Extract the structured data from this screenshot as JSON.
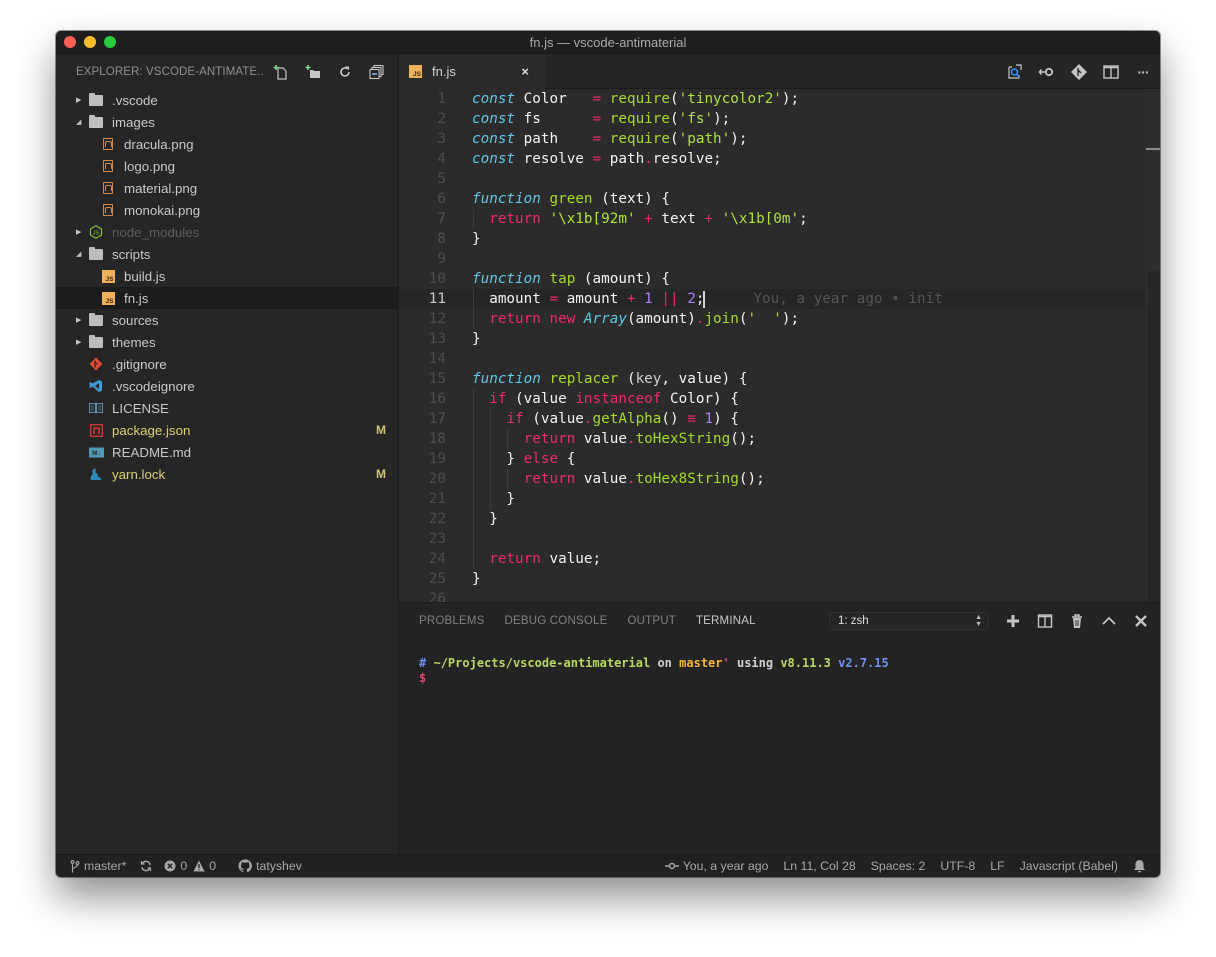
{
  "window": {
    "title": "fn.js — vscode-antimaterial"
  },
  "sidebar": {
    "title": "EXPLORER: VSCODE-ANTIMATE...",
    "actions": [
      "new-file",
      "new-folder",
      "refresh",
      "collapse-all"
    ],
    "items": [
      {
        "label": ".vscode",
        "type": "folder",
        "expanded": false,
        "depth": 0
      },
      {
        "label": "images",
        "type": "folder",
        "expanded": true,
        "depth": 0
      },
      {
        "label": "dracula.png",
        "type": "png",
        "depth": 1
      },
      {
        "label": "logo.png",
        "type": "png",
        "depth": 1
      },
      {
        "label": "material.png",
        "type": "png",
        "depth": 1
      },
      {
        "label": "monokai.png",
        "type": "png",
        "depth": 1
      },
      {
        "label": "node_modules",
        "type": "node-folder",
        "expanded": false,
        "depth": 0,
        "dim": true
      },
      {
        "label": "scripts",
        "type": "folder",
        "expanded": true,
        "depth": 0
      },
      {
        "label": "build.js",
        "type": "js",
        "depth": 1
      },
      {
        "label": "fn.js",
        "type": "js",
        "depth": 1,
        "selected": true
      },
      {
        "label": "sources",
        "type": "folder",
        "expanded": false,
        "depth": 0
      },
      {
        "label": "themes",
        "type": "folder",
        "expanded": false,
        "depth": 0
      },
      {
        "label": ".gitignore",
        "type": "git",
        "depth": 0
      },
      {
        "label": ".vscodeignore",
        "type": "vscode",
        "depth": 0
      },
      {
        "label": "LICENSE",
        "type": "license",
        "depth": 0
      },
      {
        "label": "package.json",
        "type": "npm",
        "depth": 0,
        "modified": true,
        "badge": "M"
      },
      {
        "label": "README.md",
        "type": "markdown",
        "depth": 0
      },
      {
        "label": "yarn.lock",
        "type": "yarn",
        "depth": 0,
        "modified": true,
        "badge": "M"
      }
    ]
  },
  "editor": {
    "tab": {
      "label": "fn.js",
      "close": "×"
    },
    "actions": [
      "open-changes",
      "toggle-blame",
      "git-lens",
      "split-editor",
      "more"
    ],
    "more_label": "···",
    "current_line": 11,
    "blame": "You, a year ago • init",
    "lines": [
      [
        [
          "k-it",
          "const"
        ],
        [
          "",
          "Color   "
        ],
        [
          "k-pink",
          "= "
        ],
        [
          "k-green",
          "require"
        ],
        [
          "",
          "("
        ],
        [
          "k-str",
          "'tinycolor2'"
        ],
        [
          "",
          "); "
        ]
      ],
      [
        [
          "k-it",
          "const"
        ],
        [
          "",
          "fs      "
        ],
        [
          "k-pink",
          "= "
        ],
        [
          "k-green",
          "require"
        ],
        [
          "",
          "("
        ],
        [
          "k-str",
          "'fs'"
        ],
        [
          "",
          ");"
        ]
      ],
      [
        [
          "k-it",
          "const"
        ],
        [
          "",
          "path    "
        ],
        [
          "k-pink",
          "= "
        ],
        [
          "k-green",
          "require"
        ],
        [
          "",
          "("
        ],
        [
          "k-str",
          "'path'"
        ],
        [
          "",
          ");"
        ]
      ],
      [
        [
          "k-it",
          "const"
        ],
        [
          "",
          "resolve "
        ],
        [
          "k-pink",
          "= "
        ],
        [
          "",
          "path"
        ],
        [
          "k-dot",
          "."
        ],
        [
          "",
          "resolve;"
        ]
      ],
      [],
      [
        [
          "k-it",
          "function"
        ],
        [
          "k-green",
          " green"
        ],
        [
          "",
          " (text) {"
        ]
      ],
      [
        [
          "",
          "  "
        ],
        [
          "k-pink",
          "return "
        ],
        [
          "k-str",
          "'\\x1b[92m'"
        ],
        [
          "k-pink",
          " + "
        ],
        [
          "",
          "text"
        ],
        [
          "k-pink",
          " + "
        ],
        [
          "k-str",
          "'\\x1b[0m'"
        ],
        [
          "",
          ";"
        ]
      ],
      [
        [
          "",
          "}"
        ]
      ],
      [],
      [
        [
          "k-it",
          "function"
        ],
        [
          "k-green",
          " tap"
        ],
        [
          "",
          " (amount) {"
        ]
      ],
      [
        [
          "",
          "  amount "
        ],
        [
          "k-pink",
          "= "
        ],
        [
          "",
          "amount "
        ],
        [
          "k-pink",
          "+ "
        ],
        [
          "k-num",
          "1 "
        ],
        [
          "k-pink",
          "|| "
        ],
        [
          "k-num",
          "2"
        ],
        [
          "",
          ";"
        ]
      ],
      [
        [
          "",
          "  "
        ],
        [
          "k-pink",
          "return new "
        ],
        [
          "k-it",
          "Array"
        ],
        [
          "",
          "(amount)"
        ],
        [
          "k-dot",
          "."
        ],
        [
          "k-green",
          "join"
        ],
        [
          "",
          "("
        ],
        [
          "k-str",
          "'  '"
        ],
        [
          "",
          ");"
        ]
      ],
      [
        [
          "",
          "}"
        ]
      ],
      [],
      [
        [
          "k-it",
          "function"
        ],
        [
          "k-green",
          " replacer"
        ],
        [
          "",
          " ("
        ],
        [
          "k-gray",
          "key"
        ],
        [
          "",
          ", value) {"
        ]
      ],
      [
        [
          "",
          "  "
        ],
        [
          "k-pink",
          "if "
        ],
        [
          "",
          "(value "
        ],
        [
          "k-pink",
          "instanceof "
        ],
        [
          "",
          "Color) {"
        ]
      ],
      [
        [
          "",
          "    "
        ],
        [
          "k-pink",
          "if "
        ],
        [
          "",
          "(value"
        ],
        [
          "k-dot",
          "."
        ],
        [
          "k-green",
          "getAlpha"
        ],
        [
          "",
          "() "
        ],
        [
          "k-pink",
          "≡ "
        ],
        [
          "k-num",
          "1"
        ],
        [
          "",
          ") {"
        ]
      ],
      [
        [
          "",
          "      "
        ],
        [
          "k-pink",
          "return "
        ],
        [
          "",
          "value"
        ],
        [
          "k-dot",
          "."
        ],
        [
          "k-green",
          "toHexString"
        ],
        [
          "",
          "();"
        ]
      ],
      [
        [
          "",
          "    } "
        ],
        [
          "k-pink",
          "else "
        ],
        [
          "",
          "{"
        ]
      ],
      [
        [
          "",
          "      "
        ],
        [
          "k-pink",
          "return "
        ],
        [
          "",
          "value"
        ],
        [
          "k-dot",
          "."
        ],
        [
          "k-green",
          "toHex8String"
        ],
        [
          "",
          "();"
        ]
      ],
      [
        [
          "",
          "    }"
        ]
      ],
      [
        [
          "",
          "  }"
        ]
      ],
      [],
      [
        [
          "",
          "  "
        ],
        [
          "k-pink",
          "return "
        ],
        [
          "",
          "value;"
        ]
      ],
      [
        [
          "",
          "}"
        ]
      ],
      []
    ]
  },
  "panel": {
    "tabs": [
      {
        "label": "PROBLEMS",
        "active": false
      },
      {
        "label": "DEBUG CONSOLE",
        "active": false
      },
      {
        "label": "OUTPUT",
        "active": false
      },
      {
        "label": "TERMINAL",
        "active": true
      }
    ],
    "terminal_select": "1: zsh",
    "actions": [
      "new-terminal",
      "split-terminal",
      "kill-terminal",
      "maximize-panel",
      "close-panel"
    ],
    "terminal": {
      "hash": "#",
      "path": "~/Projects/vscode-antimaterial",
      "on": "on",
      "branch": "master",
      "tick": "'",
      "using": "using",
      "node_version": "v8.11.3",
      "python_version": "v2.7.15",
      "prompt": "$"
    }
  },
  "statusbar": {
    "branch": "master*",
    "errors": "0",
    "warnings": "0",
    "user": "tatyshev",
    "blame": "You, a year ago",
    "position": "Ln 11, Col 28",
    "indent": "Spaces: 2",
    "encoding": "UTF-8",
    "eol": "LF",
    "language": "Javascript (Babel)"
  }
}
